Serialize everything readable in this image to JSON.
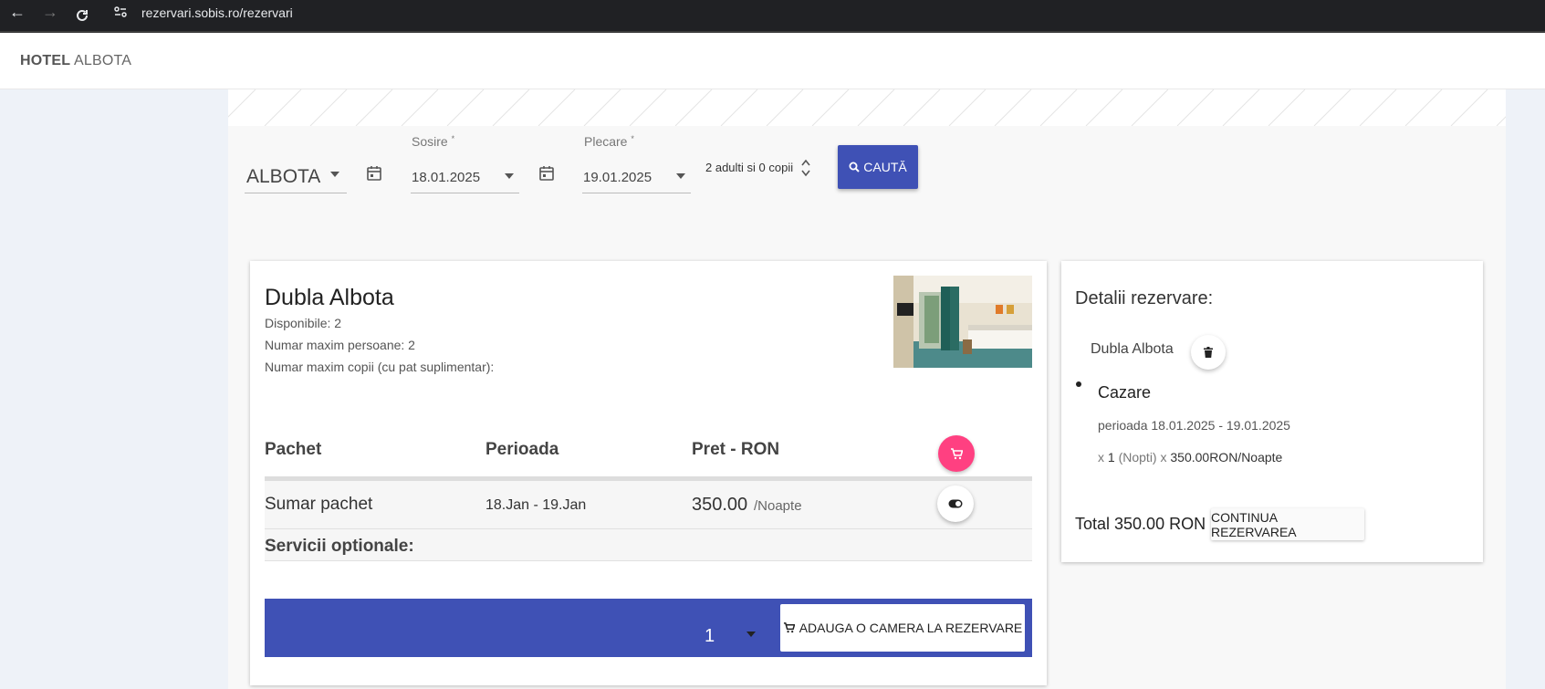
{
  "browser": {
    "url": "rezervari.sobis.ro/rezervari"
  },
  "brand": {
    "bold": "HOTEL",
    "name": "ALBOTA"
  },
  "search": {
    "hotel": "ALBOTA",
    "arrival_label": "Sosire",
    "arrival_value": "18.01.2025",
    "departure_label": "Plecare",
    "departure_value": "19.01.2025",
    "required_marker": "*",
    "guests": "2 adulti si 0 copii",
    "button_label": "CAUTĂ"
  },
  "room": {
    "title": "Dubla Albota",
    "available": "Disponibile: 2",
    "max_persons": "Numar maxim persoane: 2",
    "max_children": "Numar maxim copii (cu pat suplimentar):",
    "table": {
      "headers": [
        "Pachet",
        "Perioada",
        "Pret - RON"
      ],
      "row": {
        "package": "Sumar pachet",
        "period": "18.Jan - 19.Jan",
        "price": "350.00",
        "unit": "/Noapte"
      },
      "optional_services": "Servicii optionale:"
    },
    "quantity": "1",
    "add_button": "ADAUGA O CAMERA LA REZERVARE"
  },
  "details": {
    "title": "Detalii rezervare:",
    "room": "Dubla Albota",
    "service": "Cazare",
    "period": "perioada 18.01.2025 - 19.01.2025",
    "calc_prefix": "x",
    "nights_count": "1",
    "nights_label": "(Nopti)",
    "calc_x": "x",
    "rate": "350.00RON/Noapte",
    "total": "Total 350.00 RON",
    "continue_button": "CONTINUA REZERVAREA"
  },
  "colors": {
    "primary": "#3f51b5",
    "accent": "#ff4081"
  },
  "icons": [
    "back-arrow-icon",
    "forward-arrow-icon",
    "reload-icon",
    "site-settings-icon",
    "calendar-icon",
    "search-icon",
    "cart-icon",
    "toggle-icon",
    "trash-icon",
    "sort-arrows-icon"
  ]
}
